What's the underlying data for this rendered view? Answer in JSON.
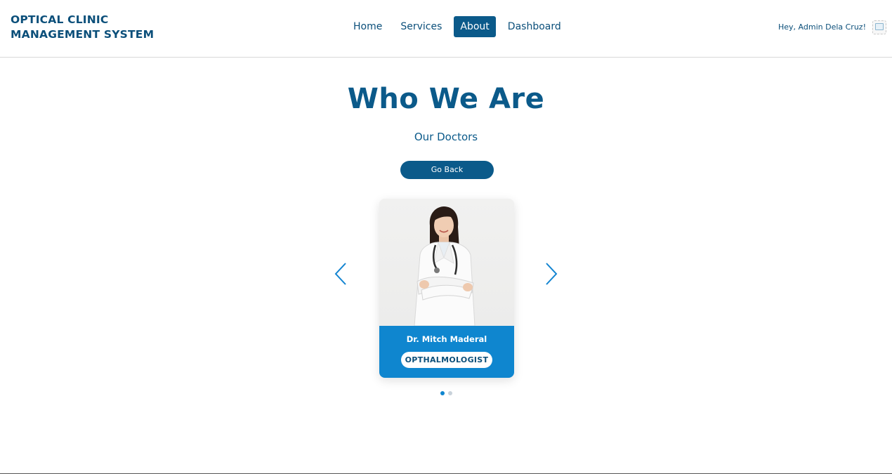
{
  "brand": {
    "line1": "OPTICAL CLINIC",
    "line2": "MANAGEMENT SYSTEM"
  },
  "nav": {
    "items": [
      {
        "label": "Home",
        "active": false
      },
      {
        "label": "Services",
        "active": false
      },
      {
        "label": "About",
        "active": true
      },
      {
        "label": "Dashboard",
        "active": false
      }
    ]
  },
  "user": {
    "greeting": "Hey, Admin Dela Cruz!",
    "avatar_icon": "broken-image-icon"
  },
  "hero": {
    "title": "Who We Are",
    "subtitle": "Our Doctors",
    "back_label": "Go Back"
  },
  "carousel": {
    "prev_icon": "chevron-left-icon",
    "next_icon": "chevron-right-icon",
    "slides": [
      {
        "name": "Dr. Mitch Maderal",
        "role": "OPTHALMOLOGIST"
      }
    ],
    "dot_count": 2,
    "active_dot": 0
  },
  "colors": {
    "primary": "#0b5a8a",
    "accent": "#0f86cf",
    "text": "#0b4f7a"
  }
}
